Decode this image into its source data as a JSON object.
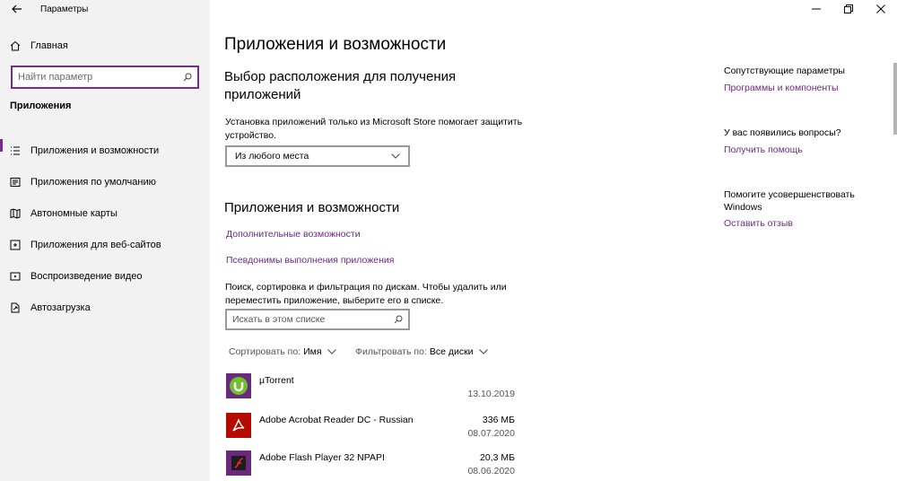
{
  "window": {
    "title": "Параметры",
    "controls": [
      "minimize",
      "maximize",
      "close"
    ]
  },
  "sidebar": {
    "home_label": "Главная",
    "search_placeholder": "Найти параметр",
    "section_title": "Приложения",
    "items": [
      {
        "label": "Приложения и возможности",
        "icon": "list-icon",
        "active": true
      },
      {
        "label": "Приложения по умолчанию",
        "icon": "default-apps-icon",
        "active": false
      },
      {
        "label": "Автономные карты",
        "icon": "map-icon",
        "active": false
      },
      {
        "label": "Приложения для веб-сайтов",
        "icon": "web-app-icon",
        "active": false
      },
      {
        "label": "Воспроизведение видео",
        "icon": "video-icon",
        "active": false
      },
      {
        "label": "Автозагрузка",
        "icon": "startup-icon",
        "active": false
      }
    ]
  },
  "main": {
    "page_title": "Приложения и возможности",
    "install_section": {
      "heading": "Выбор расположения для получения приложений",
      "description": "Установка приложений только из Microsoft Store помогает защитить устройство.",
      "select_value": "Из любого места"
    },
    "apps_section": {
      "heading": "Приложения и возможности",
      "link_optional": "Дополнительные возможности",
      "link_aliases": "Псевдонимы выполнения приложения",
      "description": "Поиск, сортировка и фильтрация по дискам. Чтобы удалить или переместить приложение, выберите его в списке.",
      "search_placeholder": "Искать в этом списке",
      "sort_label": "Сортировать по:",
      "sort_value": "Имя",
      "filter_label": "Фильтровать по:",
      "filter_value": "Все диски",
      "apps": [
        {
          "name": "µTorrent",
          "size": "",
          "date": "13.10.2019",
          "icon": "utorrent-icon",
          "color": "#6a2a7c"
        },
        {
          "name": "Adobe Acrobat Reader DC - Russian",
          "size": "336 МБ",
          "date": "08.07.2020",
          "icon": "acrobat-icon",
          "color": "#b30b00"
        },
        {
          "name": "Adobe Flash Player 32 NPAPI",
          "size": "20,3 МБ",
          "date": "08.06.2020",
          "icon": "flash-icon",
          "color": "#6a2a7c"
        }
      ]
    }
  },
  "right": {
    "related_title": "Сопутствующие параметры",
    "related_link": "Программы и компоненты",
    "questions_title": "У вас появились вопросы?",
    "questions_link": "Получить помощь",
    "improve_title": "Помогите усовершенствовать Windows",
    "improve_link": "Оставить отзыв"
  },
  "colors": {
    "accent": "#7a2c8c",
    "link": "#6b2a80",
    "sidebar_bg": "#f2f2f2"
  }
}
